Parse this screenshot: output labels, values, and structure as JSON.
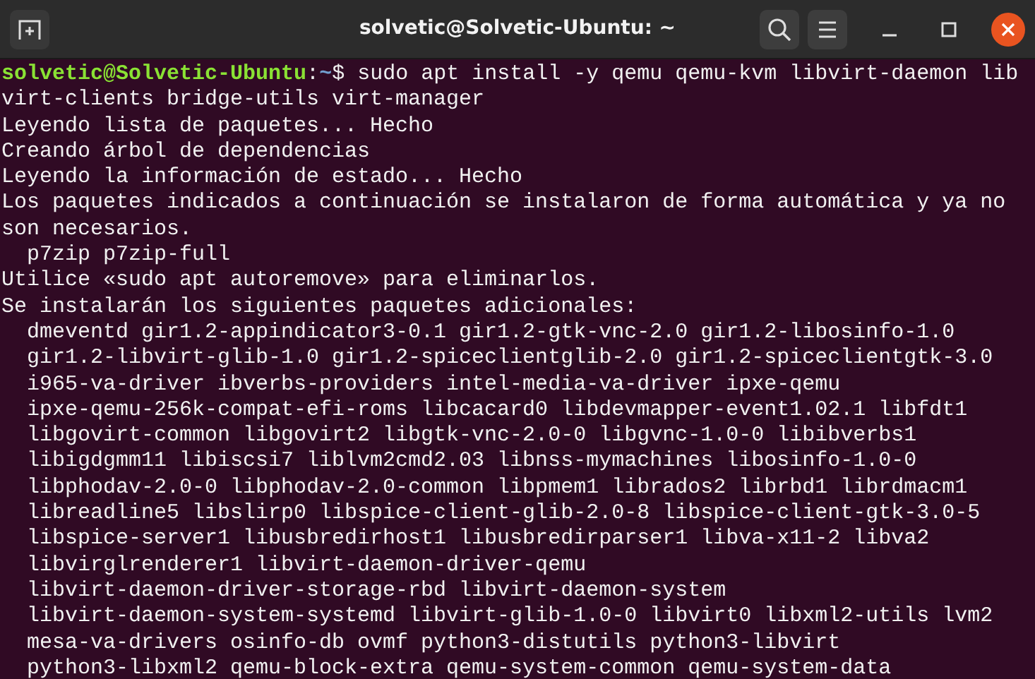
{
  "window": {
    "title": "solvetic@Solvetic-Ubuntu: ~"
  },
  "terminal": {
    "lines": [
      {
        "kind": "prompt",
        "user_host": "solvetic@Solvetic-Ubuntu",
        "separator": ":",
        "path": "~",
        "symbol": "$",
        "command": "sudo apt install -y qemu qemu-kvm libvirt-daemon lib"
      },
      {
        "kind": "output",
        "text": "virt-clients bridge-utils virt-manager"
      },
      {
        "kind": "output",
        "text": "Leyendo lista de paquetes... Hecho"
      },
      {
        "kind": "output",
        "text": "Creando árbol de dependencias"
      },
      {
        "kind": "output",
        "text": "Leyendo la información de estado... Hecho"
      },
      {
        "kind": "output",
        "text": "Los paquetes indicados a continuación se instalaron de forma automática y ya no"
      },
      {
        "kind": "output",
        "text": "son necesarios."
      },
      {
        "kind": "output",
        "text": "  p7zip p7zip-full"
      },
      {
        "kind": "output",
        "text": "Utilice «sudo apt autoremove» para eliminarlos."
      },
      {
        "kind": "output",
        "text": "Se instalarán los siguientes paquetes adicionales:"
      },
      {
        "kind": "output",
        "text": "  dmeventd gir1.2-appindicator3-0.1 gir1.2-gtk-vnc-2.0 gir1.2-libosinfo-1.0"
      },
      {
        "kind": "output",
        "text": "  gir1.2-libvirt-glib-1.0 gir1.2-spiceclientglib-2.0 gir1.2-spiceclientgtk-3.0"
      },
      {
        "kind": "output",
        "text": "  i965-va-driver ibverbs-providers intel-media-va-driver ipxe-qemu"
      },
      {
        "kind": "output",
        "text": "  ipxe-qemu-256k-compat-efi-roms libcacard0 libdevmapper-event1.02.1 libfdt1"
      },
      {
        "kind": "output",
        "text": "  libgovirt-common libgovirt2 libgtk-vnc-2.0-0 libgvnc-1.0-0 libibverbs1"
      },
      {
        "kind": "output",
        "text": "  libigdgmm11 libiscsi7 liblvm2cmd2.03 libnss-mymachines libosinfo-1.0-0"
      },
      {
        "kind": "output",
        "text": "  libphodav-2.0-0 libphodav-2.0-common libpmem1 librados2 librbd1 librdmacm1"
      },
      {
        "kind": "output",
        "text": "  libreadline5 libslirp0 libspice-client-glib-2.0-8 libspice-client-gtk-3.0-5"
      },
      {
        "kind": "output",
        "text": "  libspice-server1 libusbredirhost1 libusbredirparser1 libva-x11-2 libva2"
      },
      {
        "kind": "output",
        "text": "  libvirglrenderer1 libvirt-daemon-driver-qemu"
      },
      {
        "kind": "output",
        "text": "  libvirt-daemon-driver-storage-rbd libvirt-daemon-system"
      },
      {
        "kind": "output",
        "text": "  libvirt-daemon-system-systemd libvirt-glib-1.0-0 libvirt0 libxml2-utils lvm2"
      },
      {
        "kind": "output",
        "text": "  mesa-va-drivers osinfo-db ovmf python3-distutils python3-libvirt"
      },
      {
        "kind": "output",
        "text": "  python3-libxml2 qemu-block-extra qemu-system-common qemu-system-data"
      }
    ]
  }
}
